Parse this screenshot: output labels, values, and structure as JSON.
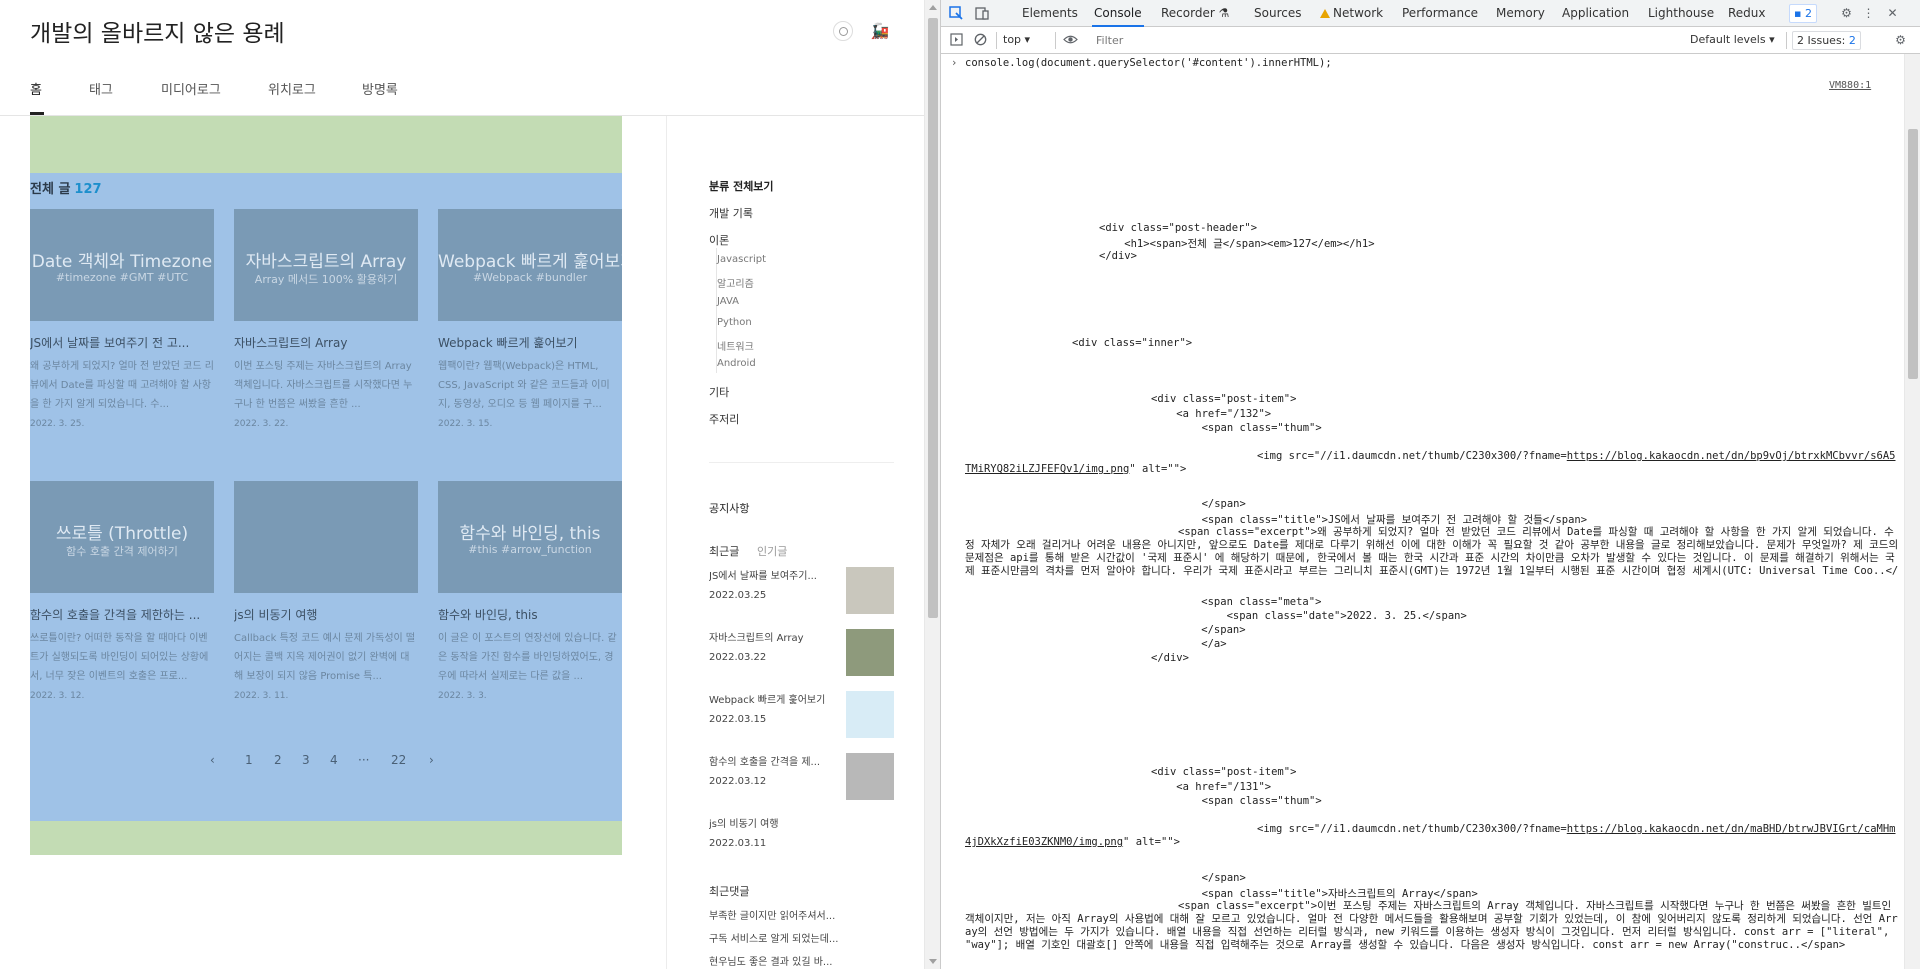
{
  "blog": {
    "site_title": "개발의 올바르지 않은 용례",
    "nav": [
      "홈",
      "태그",
      "미디어로그",
      "위치로그",
      "방명록"
    ],
    "header_label": "전체 글",
    "header_count": "127",
    "posts": [
      {
        "thumb_title": "Date 객체와 Timezone",
        "thumb_sub": "#timezone #GMT #UTC",
        "title": "JS에서 날짜를 보여주기 전 고...",
        "excerpt": "왜 공부하게 되었지? 얼마 전 받았던 코드 리뷰에서 Date를 파싱할 때 고려해야 할 사항을 한 가지 알게 되었습니다. 수...",
        "date": "2022. 3. 25."
      },
      {
        "thumb_title": "자바스크립트의 Array",
        "thumb_sub": "Array 메서드 100% 활용하기",
        "title": "자바스크립트의 Array",
        "excerpt": "이번 포스팅 주제는 자바스크립트의 Array 객체입니다. 자바스크립트를 시작했다면 누구나 한 번쯤은 써봤을 흔한 ...",
        "date": "2022. 3. 22."
      },
      {
        "thumb_title": "Webpack 빠르게 훑어보기",
        "thumb_sub": "#Webpack #bundler",
        "title": "Webpack 빠르게 훑어보기",
        "excerpt": "웹팩이란? 웹팩(Webpack)은 HTML, CSS, JavaScript 와 같은 코드들과 이미지, 동영상, 오디오 등 웹 페이지를 구...",
        "date": "2022. 3. 15."
      },
      {
        "thumb_title": "쓰로틀 (Throttle)",
        "thumb_sub": "함수 호출 간격 제어하기",
        "title": "함수의 호출을 간격을 제한하는 ...",
        "excerpt": "쓰로틀이란? 어떠한 동작을 할 때마다 이벤트가 실행되도록 바인딩이 되어있는 상황에서, 너무 잦은 이벤트의 호출은 프로...",
        "date": "2022. 3. 12."
      },
      {
        "thumb_title": "",
        "thumb_sub": "",
        "title": "js의 비동기 여행",
        "excerpt": "Callback 특정 코드 예시 문제 가독성이 떨어지는 콜백 지옥 제어권이 없기 완벽에 대해 보장이 되지 않음 Promise 특...",
        "date": "2022. 3. 11."
      },
      {
        "thumb_title": "함수와 바인딩, this",
        "thumb_sub": "#this #arrow_function",
        "title": "함수와 바인딩, this",
        "excerpt": "이 글은 이 포스트의 연장선에 있습니다. 같은 동작을 가진 함수를 바인딩하였어도, 경우에 따라서 실제로는 다른 값을 ...",
        "date": "2022. 3. 3."
      }
    ],
    "pager": [
      "‹",
      "1",
      "2",
      "3",
      "4",
      "···",
      "22",
      "›"
    ],
    "sidebar": {
      "cat_all": "분류 전체보기",
      "cat_dev": "개발 기록",
      "cat_theory": "이론",
      "theory_sub": [
        "Javascript",
        "알고리즘",
        "JAVA",
        "Python",
        "네트워크",
        "Android"
      ],
      "cat_etc": "기타",
      "cat_misc": "주저리",
      "notice": "공지사항",
      "recent_tab": "최근글",
      "popular_tab": "인기글",
      "recent": [
        {
          "title": "JS에서 날짜를 보여주기...",
          "date": "2022.03.25"
        },
        {
          "title": "자바스크립트의 Array",
          "date": "2022.03.22"
        },
        {
          "title": "Webpack 빠르게 훑어보기",
          "date": "2022.03.15"
        },
        {
          "title": "함수의 호출을 간격을 제...",
          "date": "2022.03.12"
        },
        {
          "title": "js의 비동기 여행",
          "date": "2022.03.11"
        }
      ],
      "comments_head": "최근댓글",
      "comments": [
        "부족한 글이지만 읽어주셔서...",
        "구독 서비스로 알게 되었는데...",
        "현우님도 좋은 결과 있길 바..."
      ]
    }
  },
  "devtools": {
    "tabs": [
      "Elements",
      "Console",
      "Recorder",
      "Sources",
      "Network",
      "Performance",
      "Memory",
      "Application",
      "Lighthouse",
      "Redux"
    ],
    "active_tab": "Console",
    "msg_badge": "2",
    "context": "top",
    "filter_placeholder": "Filter",
    "levels": "Default levels",
    "issues_label": "2 Issues:",
    "issues_count": "2",
    "command": "console.log(document.querySelector('#content').innerHTML);",
    "source_link": "VM880:1",
    "lines": [
      "<div class=\"post-header\">",
      "    <h1><span>전체 글</span><em>127</em></h1>",
      "</div>",
      "<div class=\"inner\">",
      "<div class=\"post-item\">",
      "    <a href=\"/132\">",
      "        <span class=\"thum\">",
      "<img src=\"//i1.daumcdn.net/thumb/C230x300/?fname=",
      "https://blog.kakaocdn.net/dn/bp9vOj/btrxkMCbvvr/s6A5TMiRYQ82iLZJFEFQv1/img.png",
      "\" alt=\"\">",
      "        </span>",
      "        <span class=\"title\">JS에서 날짜를 보여주기 전 고려해야 할 것들</span>",
      "        <span class=\"excerpt\">왜 공부하게 되었지? 얼마 전 받았던 코드 리뷰에서 Date를 파싱할 때 고려해야 할 사항을 한 가지 알게 되었습니다. 수정 자체가 오래 걸리거나 어려운 내용은 아니지만, 앞으로도 Date를 제대로 다루기 위해선 이에 대한 이해가 꼭 필요할 것 같아 공부한 내용을 글로 정리해보았습니다. 문제가 무엇일까? 제 코드의 문제점은 api를 통해 받은 시간값이 '국제 표준시' 에 해당하기 때문에, 한국에서 볼 때는 한국 시간과 표준 시간의 차이만큼 오차가 발생할 수 있다는 것입니다. 이 문제를 해결하기 위해서는 국제 표준시만큼의 격차를 먼저 알아야 합니다. 우리가 국제 표준시라고 부르는 그리니치 표준시(GMT)는 1972년 1월 1일부터 시행된 표준 시간이며 협정 세계시(UTC: Universal Time Coo..</span>",
      "    <span class=\"meta\">",
      "        <span class=\"date\">2022. 3. 25.</span>",
      "    </span>",
      "    </a>",
      "</div>",
      "<div class=\"post-item\">",
      "    <a href=\"/131\">",
      "        <span class=\"thum\">",
      "<img src=\"//i1.daumcdn.net/thumb/C230x300/?fname=",
      "https://blog.kakaocdn.net/dn/maBHD/btrwJBVIGrt/caMHm4jDXkXzfiE03ZKNM0/img.png",
      "\" alt=\"\">",
      "        </span>",
      "        <span class=\"title\">자바스크립트의 Array</span>",
      "        <span class=\"excerpt\">이번 포스팅 주제는 자바스크립트의 Array 객체입니다. 자바스크립트를 시작했다면 누구나 한 번쯤은 써봤을 흔한 빌트인 객체이지만, 저는 아직 Array의 사용법에 대해 잘 모르고 있었습니다. 얼마 전 다양한 메서드들을 활용해보며 공부할 기회가 있었는데, 이 참에 잊어버리지 않도록 정리하게 되었습니다. 선언 Array의 선언 방법에는 두 가지가 있습니다. 배열 내용을 직접 선언하는 리터럴 방식과, new 키워드를 이용하는 생성자 방식이 그것입니다. 먼저 리터럴 방식입니다. const arr = [\"literal\", \"way\"]; 배열 기호인 대괄호[] 안쪽에 내용을 직접 입력해주는 것으로 Array를 생성할 수 있습니다. 다음은 생성자 방식입니다. const arr = new Array(\"construc..</span>"
    ]
  }
}
